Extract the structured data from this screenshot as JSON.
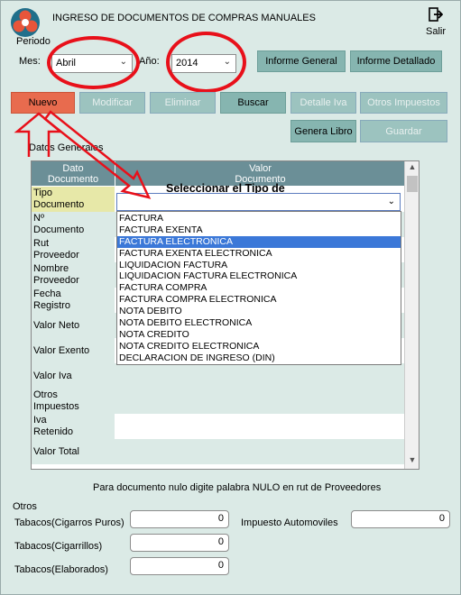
{
  "window": {
    "title": "INGRESO DE DOCUMENTOS DE COMPRAS MANUALES",
    "periodo_label": "Periodo",
    "exit_label": "Salir"
  },
  "period": {
    "mes_label": "Mes:",
    "mes_value": "Abril",
    "anio_label": "Año:",
    "anio_value": "2014"
  },
  "buttons": {
    "informe_general": "Informe General",
    "informe_detallado": "Informe Detallado",
    "nuevo": "Nuevo",
    "modificar": "Modificar",
    "eliminar": "Eliminar",
    "buscar": "Buscar",
    "detalle_iva": "Detalle Iva",
    "otros_impuestos": "Otros Impuestos",
    "genera_libro": "Genera Libro",
    "guardar": "Guardar"
  },
  "datos_generales_label": "Datos Generales",
  "grid": {
    "col_dato": "Dato\nDocumento",
    "col_valor": "Valor\nDocumento",
    "rows": [
      "Tipo\nDocumento",
      "Nº\nDocumento",
      "Rut\nProveedor",
      "Nombre\nProveedor",
      "Fecha\nRegistro",
      "Valor Neto",
      "Valor Exento",
      "Valor Iva",
      "Otros\nImpuestos",
      "Iva\nRetenido",
      "Valor Total"
    ]
  },
  "annotation": "Seleccionar el Tipo de\nDocumento",
  "tipo_documento_options": [
    "FACTURA",
    "FACTURA EXENTA",
    "FACTURA ELECTRONICA",
    "FACTURA EXENTA ELECTRONICA",
    "LIQUIDACION FACTURA",
    "LIQUIDACION FACTURA ELECTRONICA",
    "FACTURA COMPRA",
    "FACTURA COMPRA ELECTRONICA",
    "NOTA DEBITO",
    "NOTA DEBITO ELECTRONICA",
    "NOTA CREDITO",
    "NOTA CREDITO ELECTRONICA",
    "DECLARACION DE INGRESO (DIN)"
  ],
  "highlighted_option": "FACTURA ELECTRONICA",
  "note": "Para documento nulo digite palabra NULO en rut de Proveedores",
  "otros": {
    "label": "Otros",
    "cigarros_puros_label": "Tabacos(Cigarros Puros)",
    "cigarros_puros_value": "0",
    "cigarrillos_label": "Tabacos(Cigarrillos)",
    "cigarrillos_value": "0",
    "elaborados_label": "Tabacos(Elaborados)",
    "elaborados_value": "0",
    "automoviles_label": "Impuesto Automoviles",
    "automoviles_value": "0"
  },
  "colors": {
    "background": "#dbeae6",
    "button": "#86b5b0",
    "nuevo_button": "#e86b4e",
    "grid_header": "#6b8f97",
    "highlight": "#3b78d8",
    "annotation_red": "#e8101a"
  }
}
